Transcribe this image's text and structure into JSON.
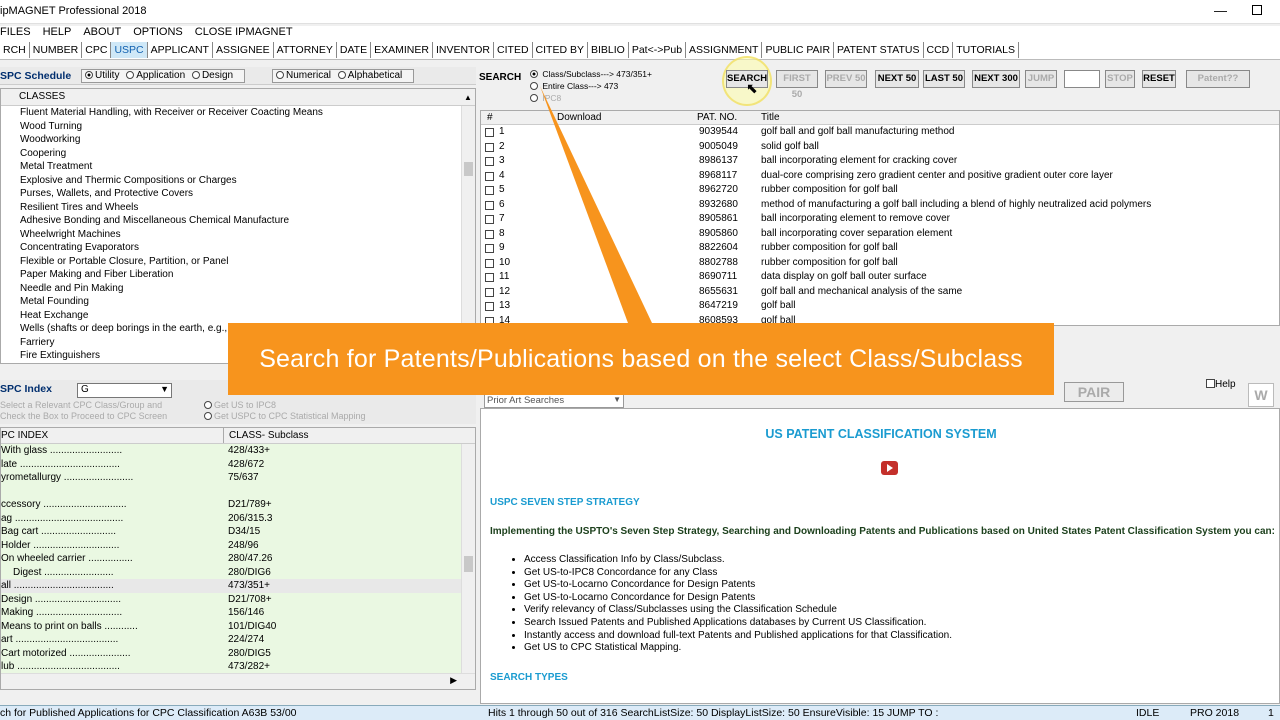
{
  "title": "ipMAGNET Professional 2018",
  "window_controls": {
    "min": "—"
  },
  "menu": [
    "FILES",
    "HELP",
    "ABOUT",
    "OPTIONS",
    "CLOSE IPMAGNET"
  ],
  "tabs": [
    "RCH",
    "NUMBER",
    "CPC",
    "USPC",
    "APPLICANT",
    "ASSIGNEE",
    "ATTORNEY",
    "DATE",
    "EXAMINER",
    "INVENTOR",
    "CITED",
    "CITED BY",
    "BIBLIO",
    "Pat<->Pub",
    "ASSIGNMENT",
    "PUBLIC PAIR",
    "PATENT STATUS",
    "CCD",
    "TUTORIALS"
  ],
  "active_tab": "USPC",
  "schedule": {
    "label": "SPC Schedule",
    "opts": [
      "Utility",
      "Application",
      "Design"
    ],
    "opts2": [
      "Numerical",
      "Alphabetical"
    ]
  },
  "classes": {
    "header": "CLASSES",
    "rows": [
      "Fluent Material Handling, with Receiver or Receiver Coacting Means",
      "Wood Turning",
      "Woodworking",
      "Coopering",
      "Metal Treatment",
      "Explosive and Thermic Compositions or Charges",
      "Purses, Wallets, and Protective Covers",
      "Resilient Tires and Wheels",
      "Adhesive Bonding and Miscellaneous Chemical Manufacture",
      "Wheelwright Machines",
      "Concentrating Evaporators",
      "Flexible or Portable Closure, Partition, or Panel",
      "Paper Making and Fiber Liberation",
      "Needle and Pin Making",
      "Metal Founding",
      "Heat Exchange",
      "Wells (shafts or deep borings in the earth, e.g.,",
      "Farriery",
      "Fire Extinguishers"
    ]
  },
  "search": {
    "label": "SEARCH",
    "opts": [
      "Class/Subclass---> 473/351+",
      "Entire Class---> 473",
      "IPC8"
    ],
    "buttons": [
      "SEARCH",
      "FIRST 50",
      "PREV 50",
      "NEXT 50",
      "LAST 50",
      "NEXT 300",
      "JUMP",
      "STOP",
      "RESET",
      "Patent??"
    ]
  },
  "results": {
    "headers": [
      "#",
      "Download",
      "PAT. NO.",
      "Title"
    ],
    "rows": [
      [
        "1",
        "9039544",
        "golf ball and golf ball manufacturing method"
      ],
      [
        "2",
        "9005049",
        "solid golf ball"
      ],
      [
        "3",
        "8986137",
        "ball incorporating element for cracking cover"
      ],
      [
        "4",
        "8968117",
        "dual-core comprising zero gradient center and positive gradient outer core layer"
      ],
      [
        "5",
        "8962720",
        "rubber composition for golf ball"
      ],
      [
        "6",
        "8932680",
        "method of manufacturing a golf ball including a blend of highly neutralized acid polymers"
      ],
      [
        "7",
        "8905861",
        "ball incorporating element to remove cover"
      ],
      [
        "8",
        "8905860",
        "ball incorporating cover separation element"
      ],
      [
        "9",
        "8822604",
        "rubber composition for golf ball"
      ],
      [
        "10",
        "8802788",
        "rubber composition for golf ball"
      ],
      [
        "11",
        "8690711",
        "data display on golf ball outer surface"
      ],
      [
        "12",
        "8655631",
        "golf ball and mechanical analysis of the same"
      ],
      [
        "13",
        "8647219",
        "golf ball"
      ],
      [
        "14",
        "8608593",
        "golf ball"
      ]
    ]
  },
  "banner": "Search for Patents/Publications based on the select Class/Subclass",
  "index": {
    "label": "SPC Index",
    "select_value": "G",
    "hint1": "Select a Relevant CPC Class/Group and",
    "hint2": "Check the Box to Proceed to CPC Screen",
    "opts": [
      "Get US to IPC8",
      "Get USPC to CPC Statistical Mapping"
    ],
    "headers": [
      "PC INDEX",
      "CLASS- Subclass"
    ],
    "rows": [
      [
        "With glass ..........................",
        "428/433+"
      ],
      [
        "late ....................................",
        "428/672"
      ],
      [
        "yrometallurgy .........................",
        "75/637"
      ],
      [
        "",
        ""
      ],
      [
        "ccessory ..............................",
        "D21/789+"
      ],
      [
        "ag .......................................",
        "206/315.3"
      ],
      [
        "Bag cart ...........................",
        "D34/15"
      ],
      [
        "Holder ...............................",
        "248/96"
      ],
      [
        "On wheeled carrier ................",
        "280/47.26"
      ],
      [
        "Digest .........................",
        "280/DIG6"
      ],
      [
        "all ....................................",
        "473/351+"
      ],
      [
        "Design ...............................",
        "D21/708+"
      ],
      [
        "Making ...............................",
        "156/146"
      ],
      [
        "Means to print on balls ............",
        "101/DIG40"
      ],
      [
        "art .....................................",
        "224/274"
      ],
      [
        "Cart motorized ......................",
        "280/DIG5"
      ],
      [
        "lub .....................................",
        "473/282+"
      ],
      [
        "Design ...............................",
        "D21/733+"
      ]
    ]
  },
  "info": {
    "dropdown": "Prior Art Searches",
    "pair": "PAIR",
    "help": "Help",
    "title": "US PATENT CLASSIFICATION SYSTEM",
    "section": "USPC SEVEN STEP STRATEGY",
    "intro": "Implementing the USPTO's Seven Step Strategy, Searching and Downloading Patents and Publications based on United States Patent Classification System you can:",
    "bullets": [
      "Access Classification Info by Class/Subclass.",
      "Get US-to-IPC8 Concordance for any Class",
      "Get US-to-Locarno Concordance for Design Patents",
      "Get US-to-Locarno Concordance for Design Patents",
      "Verify relevancy of Class/Subclasses using the Classification Schedule",
      "Search Issued Patents and Published Applications databases by Current US Classification.",
      "Instantly access and download full-text Patents and Published applications for that Classification.",
      "Get US to CPC Statistical Mapping."
    ],
    "section2": "SEARCH TYPES"
  },
  "status": {
    "left": "ch for Published Applications for CPC Classification A63B 53/00",
    "mid": "Hits 1 through 50 out of 316   SearchListSize: 50   DisplayListSize: 50   EnsureVisible: 15   JUMP TO :",
    "idle": "IDLE",
    "pro": "PRO 2018",
    "right": "1"
  },
  "colors": {
    "banner": "#f7941d",
    "accent": "#1a9bd0",
    "status": "#dcebf8"
  }
}
